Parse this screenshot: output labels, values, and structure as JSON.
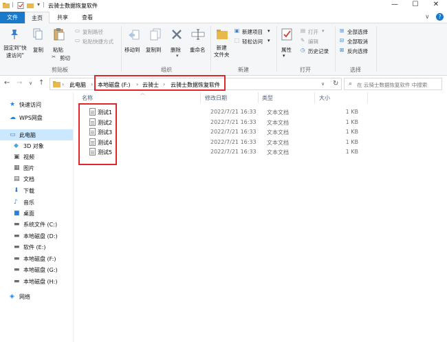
{
  "window": {
    "title": "云骑士数据恢复软件",
    "controls": {
      "minimize": "—",
      "maximize": "☐",
      "close": "✕"
    },
    "help": "?"
  },
  "tabs": {
    "file": "文件",
    "home": "主页",
    "share": "共享",
    "view": "查看"
  },
  "ribbon": {
    "clipboard": {
      "pin": "固定到\"快速访问\"",
      "copy": "复制",
      "paste": "粘贴",
      "cut": "剪切",
      "copy_path": "复制路径",
      "paste_shortcut": "粘贴快捷方式",
      "label": "剪贴板"
    },
    "organize": {
      "move_to": "移动到",
      "copy_to": "复制到",
      "delete": "删除",
      "rename": "重命名",
      "label": "组织"
    },
    "new": {
      "new_folder": "新建\n文件夹",
      "new_item": "新建项目",
      "easy_access": "轻松访问",
      "label": "新建"
    },
    "open": {
      "properties": "属性",
      "open": "打开",
      "edit": "编辑",
      "history": "历史记录",
      "label": "打开"
    },
    "select": {
      "select_all": "全部选择",
      "select_none": "全部取消",
      "invert": "反向选择",
      "label": "选择"
    }
  },
  "address": {
    "crumbs": [
      "此电脑",
      "本地磁盘 (F:)",
      "云骑士",
      "云骑士数据恢复软件"
    ],
    "search_placeholder": "在 云骑士数据恢复软件 中搜索"
  },
  "sidebar": {
    "items": [
      {
        "label": "快速访问",
        "icon": "star-icon"
      },
      {
        "label": "WPS网盘",
        "icon": "cloud-icon"
      },
      {
        "label": "此电脑",
        "icon": "computer-icon"
      },
      {
        "label": "3D 对象",
        "icon": "cube-icon"
      },
      {
        "label": "视频",
        "icon": "video-icon"
      },
      {
        "label": "图片",
        "icon": "picture-icon"
      },
      {
        "label": "文档",
        "icon": "document-icon"
      },
      {
        "label": "下载",
        "icon": "download-icon"
      },
      {
        "label": "音乐",
        "icon": "music-icon"
      },
      {
        "label": "桌面",
        "icon": "desktop-icon"
      },
      {
        "label": "系统文件 (C:)",
        "icon": "drive-icon"
      },
      {
        "label": "本地磁盘 (D:)",
        "icon": "drive-icon"
      },
      {
        "label": "软件 (E:)",
        "icon": "drive-icon"
      },
      {
        "label": "本地磁盘 (F:)",
        "icon": "drive-icon"
      },
      {
        "label": "本地磁盘 (G:)",
        "icon": "drive-icon"
      },
      {
        "label": "本地磁盘 (H:)",
        "icon": "drive-icon"
      },
      {
        "label": "网络",
        "icon": "network-icon"
      }
    ]
  },
  "columns": {
    "name": "名称",
    "date": "修改日期",
    "type": "类型",
    "size": "大小"
  },
  "files": [
    {
      "name": "测试1",
      "date": "2022/7/21 16:33",
      "type": "文本文档",
      "size": "1 KB"
    },
    {
      "name": "测试2",
      "date": "2022/7/21 16:33",
      "type": "文本文档",
      "size": "1 KB"
    },
    {
      "name": "测试3",
      "date": "2022/7/21 16:33",
      "type": "文本文档",
      "size": "1 KB"
    },
    {
      "name": "测试4",
      "date": "2022/7/21 16:33",
      "type": "文本文档",
      "size": "1 KB"
    },
    {
      "name": "测试5",
      "date": "2022/7/21 16:33",
      "type": "文本文档",
      "size": "1 KB"
    }
  ],
  "colors": {
    "accent": "#1979ca",
    "highlight": "#e0262b",
    "selection": "#cce8ff"
  }
}
